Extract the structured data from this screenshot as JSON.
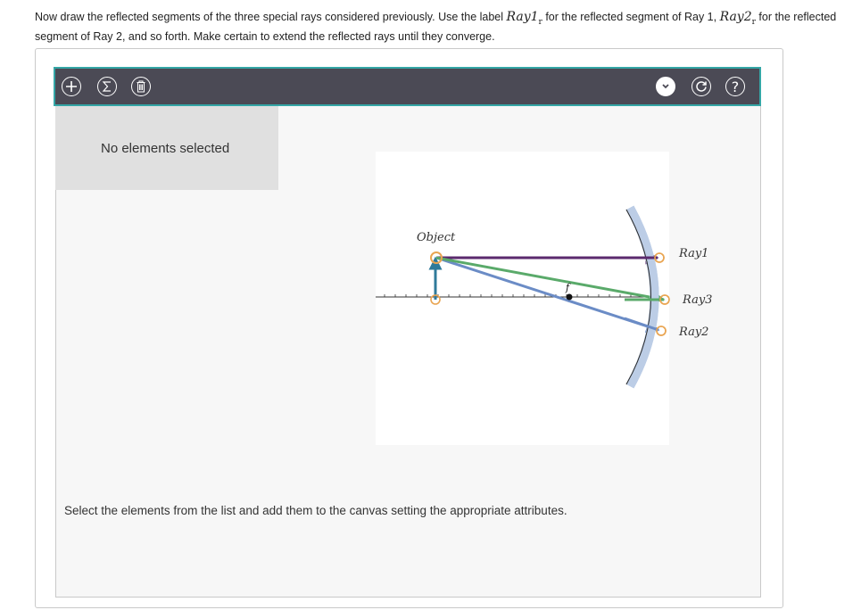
{
  "instructions": {
    "part1": "Now draw the reflected segments of the three special rays considered previously. Use the label ",
    "math1": "Ray1",
    "math1_sub": "r",
    "part2": " for the reflected segment of Ray 1, ",
    "math2": "Ray2",
    "math2_sub": "r",
    "part3": " for the reflected segment of Ray 2, and so forth. Make certain to extend the reflected rays until they converge."
  },
  "toolbar": {
    "add_icon": "plus-icon",
    "sum_icon": "sigma-icon",
    "delete_icon": "trash-icon",
    "dropdown_icon": "chevron-down-icon",
    "reset_icon": "refresh-icon",
    "help_label": "?",
    "background_color": "#4b4a55",
    "border_color": "#34a6a6"
  },
  "selection_panel": {
    "text": "No elements selected"
  },
  "diagram": {
    "object_label": "Object",
    "focal_label": "f",
    "ray_labels": [
      "Ray1",
      "Ray3",
      "Ray2"
    ],
    "colors": {
      "ray1": "#5b2a6e",
      "ray2": "#6b8cc6",
      "ray3": "#5aaa6a",
      "object_arrow": "#2f7a9a",
      "mirror": "#bccde6",
      "handle": "#e9a552"
    }
  },
  "footer": {
    "text": "Select the elements from the list and add them to the canvas setting the appropriate attributes."
  }
}
